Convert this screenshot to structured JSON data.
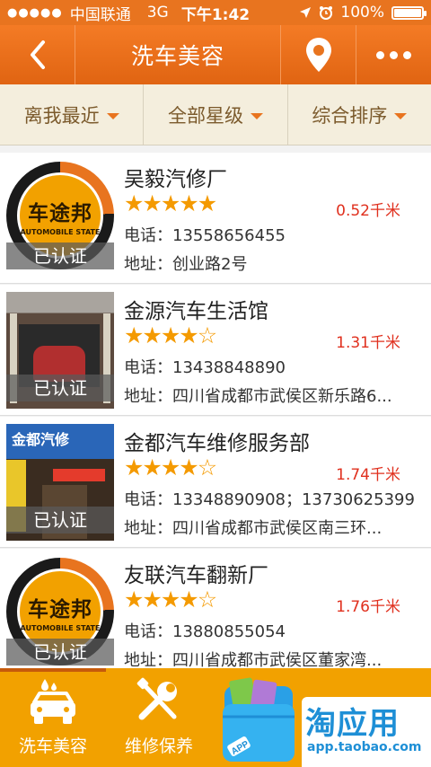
{
  "status_bar": {
    "signal": "●●●●●",
    "carrier": "中国联通",
    "network": "3G",
    "time": "下午1:42",
    "battery": "100%",
    "battery_level": 1.0
  },
  "nav": {
    "title": "洗车美容",
    "back_icon": "chevron-left-icon",
    "location_icon": "map-pin-icon",
    "more_icon": "more-dots-icon"
  },
  "filters": [
    {
      "label": "离我最近"
    },
    {
      "label": "全部星级"
    },
    {
      "label": "综合排序"
    }
  ],
  "shops": [
    {
      "name": "吴毅汽修厂",
      "rating": 5,
      "distance": "0.52千米",
      "phone": "电话：13558656455",
      "address": "地址：创业路2号",
      "verified": "已认证",
      "logo_text": "车途邦",
      "logo_sub": "AUTOMOBILE STATE"
    },
    {
      "name": "金源汽车生活馆",
      "rating": 4,
      "distance": "1.31千米",
      "phone": "电话：13438848890",
      "address": "地址：四川省成都市武侯区新乐路6...",
      "verified": "已认证"
    },
    {
      "name": "金都汽车维修服务部",
      "rating": 4,
      "distance": "1.74千米",
      "phone": "电话：13348890908；13730625399",
      "address": "地址：四川省成都市武侯区南三环...",
      "verified": "已认证",
      "photo_sign": "金都汽修"
    },
    {
      "name": "友联汽车翻新厂",
      "rating": 4,
      "distance": "1.76千米",
      "phone": "电话：13880855054",
      "address": "地址：四川省成都市武侯区董家湾...",
      "verified": "已认证",
      "logo_text": "车途邦",
      "logo_sub": "AUTOMOBILE STATE"
    }
  ],
  "tabs": [
    {
      "label": "洗车美容",
      "icon": "car-wash-icon"
    },
    {
      "label": "维修保养",
      "icon": "wrench-screwdriver-icon"
    }
  ],
  "watermark": {
    "title": "淘应用",
    "url": "app.taobao.com",
    "bag_text": "APP"
  },
  "colors": {
    "accent": "#e8741f",
    "tabbar": "#f2a100",
    "distance": "#e0301e",
    "star": "#f49a00",
    "filter_bg": "#f4eedd",
    "watermark_blue": "#1e8fd6"
  }
}
